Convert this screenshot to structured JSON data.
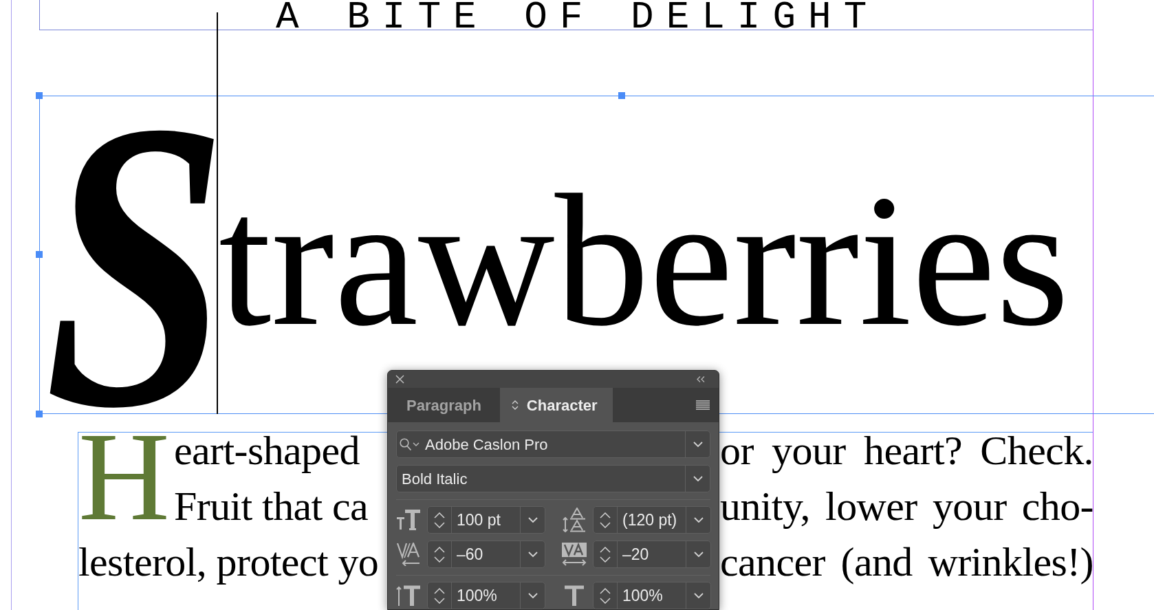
{
  "document": {
    "kicker": "A BITE OF DELIGHT",
    "headline": {
      "initial": "S",
      "rest": "trawberries"
    },
    "body": {
      "drop_cap": "H",
      "lines": [
        {
          "left": "eart-shaped",
          "right": "or your heart? Check."
        },
        {
          "left": "Fruit that ca",
          "right": "unity, lower your cho-"
        },
        {
          "left": "lesterol, protect yo",
          "right": "cancer (and wrinkles!)"
        }
      ]
    }
  },
  "character_panel": {
    "tabs": [
      {
        "label": "Paragraph",
        "selected": false
      },
      {
        "label": "Character",
        "selected": true
      }
    ],
    "font_family": "Adobe Caslon Pro",
    "font_style": "Bold Italic",
    "fields": [
      {
        "kind": "font_size",
        "value": "100 pt"
      },
      {
        "kind": "leading",
        "value": "(120 pt)"
      },
      {
        "kind": "kerning",
        "value": "–60"
      },
      {
        "kind": "tracking",
        "value": "–20"
      },
      {
        "kind": "vertical_scale",
        "value": "100%"
      },
      {
        "kind": "horizontal_scale",
        "value": "100%"
      }
    ]
  }
}
